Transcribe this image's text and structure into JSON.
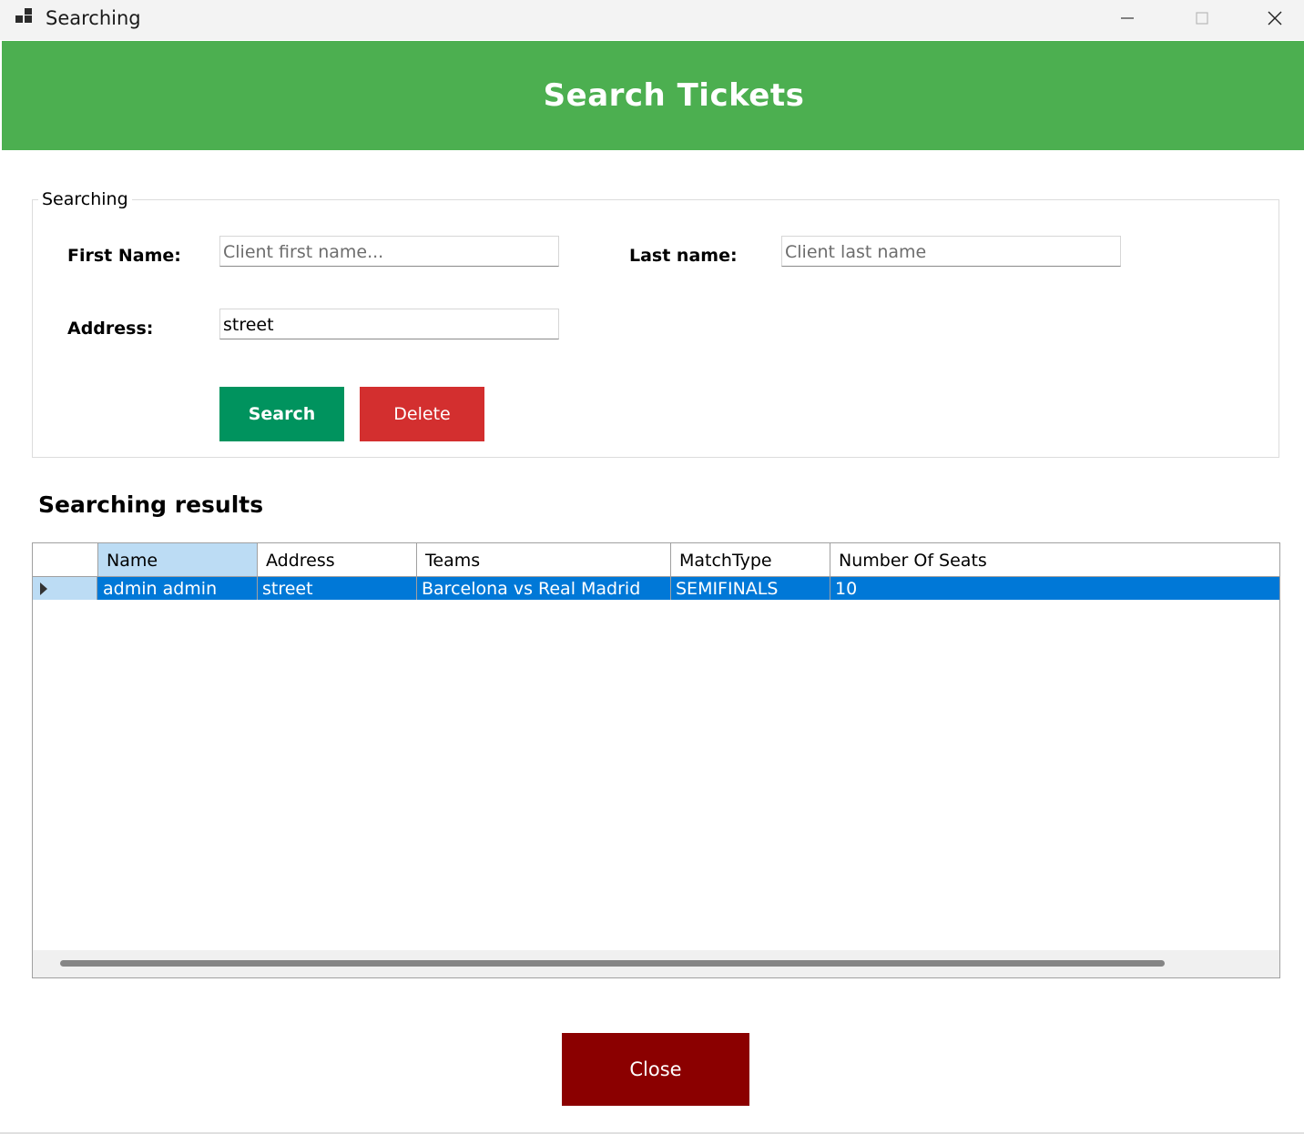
{
  "window": {
    "title": "Searching",
    "icon": "app-window-icon",
    "controls": {
      "minimize": "minimize-icon",
      "maximize": "maximize-icon",
      "close": "close-icon"
    }
  },
  "banner": {
    "title": "Search Tickets",
    "color": "#4caf50"
  },
  "search_group": {
    "legend": "Searching",
    "first_name": {
      "label": "First Name:",
      "value": "",
      "placeholder": "Client first name..."
    },
    "last_name": {
      "label": "Last name:",
      "value": "",
      "placeholder": "Client last name"
    },
    "address": {
      "label": "Address:",
      "value": "street",
      "placeholder": ""
    },
    "search_button": {
      "label": "Search",
      "color": "#00935e"
    },
    "delete_button": {
      "label": "Delete",
      "color": "#d32f2f"
    }
  },
  "results": {
    "title": "Searching results",
    "columns": [
      "Name",
      "Address",
      "Teams",
      "MatchType",
      "Number Of Seats"
    ],
    "rows": [
      {
        "name": "admin admin",
        "address": "street",
        "teams": "Barcelona vs Real Madrid",
        "match_type": "SEMIFINALS",
        "seats": "10",
        "selected": true
      }
    ],
    "selection_color": "#0078d7"
  },
  "close_button": {
    "label": "Close",
    "color": "#8b0000"
  }
}
